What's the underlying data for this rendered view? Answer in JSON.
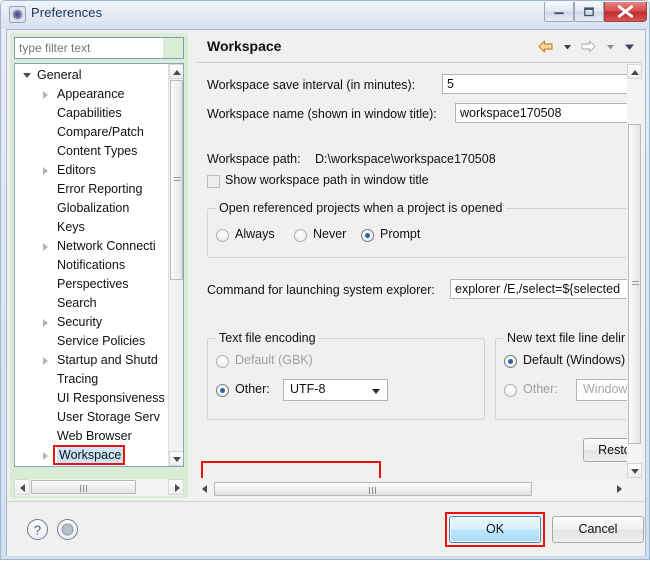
{
  "window": {
    "title": "Preferences",
    "icon": "preferences-gear-icon",
    "controls": {
      "minimize": "minimize-icon",
      "maximize": "maximize-icon",
      "close": "close-icon"
    }
  },
  "sidebar": {
    "filter": {
      "placeholder": "type filter text",
      "value": ""
    },
    "items": [
      {
        "label": "General",
        "indent": 0,
        "expander": "open",
        "selected": false
      },
      {
        "label": "Appearance",
        "indent": 1,
        "expander": "closed",
        "selected": false
      },
      {
        "label": "Capabilities",
        "indent": 1,
        "expander": "none",
        "selected": false
      },
      {
        "label": "Compare/Patch",
        "indent": 1,
        "expander": "none",
        "selected": false
      },
      {
        "label": "Content Types",
        "indent": 1,
        "expander": "none",
        "selected": false
      },
      {
        "label": "Editors",
        "indent": 1,
        "expander": "closed",
        "selected": false
      },
      {
        "label": "Error Reporting",
        "indent": 1,
        "expander": "none",
        "selected": false
      },
      {
        "label": "Globalization",
        "indent": 1,
        "expander": "none",
        "selected": false
      },
      {
        "label": "Keys",
        "indent": 1,
        "expander": "none",
        "selected": false
      },
      {
        "label": "Network Connecti",
        "indent": 1,
        "expander": "closed",
        "selected": false
      },
      {
        "label": "Notifications",
        "indent": 1,
        "expander": "none",
        "selected": false
      },
      {
        "label": "Perspectives",
        "indent": 1,
        "expander": "none",
        "selected": false
      },
      {
        "label": "Search",
        "indent": 1,
        "expander": "none",
        "selected": false
      },
      {
        "label": "Security",
        "indent": 1,
        "expander": "closed",
        "selected": false
      },
      {
        "label": "Service Policies",
        "indent": 1,
        "expander": "none",
        "selected": false
      },
      {
        "label": "Startup and Shutd",
        "indent": 1,
        "expander": "closed",
        "selected": false
      },
      {
        "label": "Tracing",
        "indent": 1,
        "expander": "none",
        "selected": false
      },
      {
        "label": "UI Responsiveness",
        "indent": 1,
        "expander": "none",
        "selected": false
      },
      {
        "label": "User Storage Serv",
        "indent": 1,
        "expander": "none",
        "selected": false
      },
      {
        "label": "Web Browser",
        "indent": 1,
        "expander": "none",
        "selected": false
      },
      {
        "label": "Workspace",
        "indent": 1,
        "expander": "closed",
        "selected": true
      }
    ]
  },
  "page": {
    "title": "Workspace",
    "nav": {
      "back_icon": "back-arrow-icon",
      "back_menu_icon": "chevron-down-icon",
      "forward_icon": "forward-arrow-icon",
      "forward_menu_icon": "chevron-down-icon",
      "view_menu_icon": "view-menu-chevron-icon"
    },
    "save_interval": {
      "label": "Workspace save interval (in minutes):",
      "value": "5"
    },
    "workspace_name": {
      "label": "Workspace name (shown in window title):",
      "value": "workspace170508"
    },
    "workspace_path": {
      "label": "Workspace path:",
      "value": "D:\\workspace\\workspace170508"
    },
    "show_path_checkbox": {
      "label": "Show workspace path in window title",
      "checked": false
    },
    "open_referenced": {
      "group_title": "Open referenced projects when a project is opened",
      "options": [
        {
          "label": "Always",
          "selected": false
        },
        {
          "label": "Never",
          "selected": false
        },
        {
          "label": "Prompt",
          "selected": true
        }
      ]
    },
    "system_explorer": {
      "label": "Command for launching system explorer:",
      "value": "explorer /E,/select=${selected"
    },
    "text_file_encoding": {
      "group_title": "Text file encoding",
      "default_option": {
        "label": "Default (GBK)",
        "selected": false
      },
      "other_option": {
        "label": "Other:",
        "selected": true
      },
      "combo_value": "UTF-8",
      "combo_arrow_icon": "chevron-down-icon",
      "highlighted": true
    },
    "line_delimiter": {
      "group_title": "New text file line delir",
      "default_option": {
        "label": "Default (Windows)",
        "selected": true
      },
      "other_option": {
        "label": "Other:",
        "selected": false
      },
      "combo_value": "Windows"
    },
    "restore_button": "Restore"
  },
  "footer": {
    "help_icon": "help-question-icon",
    "secondary_icon": "apply-circle-icon",
    "ok_label": "OK",
    "cancel_label": "Cancel",
    "ok_highlighted": true
  },
  "colors": {
    "highlight_red": "#ee1111",
    "selection_blue": "#cde6f7",
    "sidebar_green": "#d9ecd6",
    "ok_button_blue": "#bee6fd",
    "close_button_red": "#d84c4c"
  }
}
